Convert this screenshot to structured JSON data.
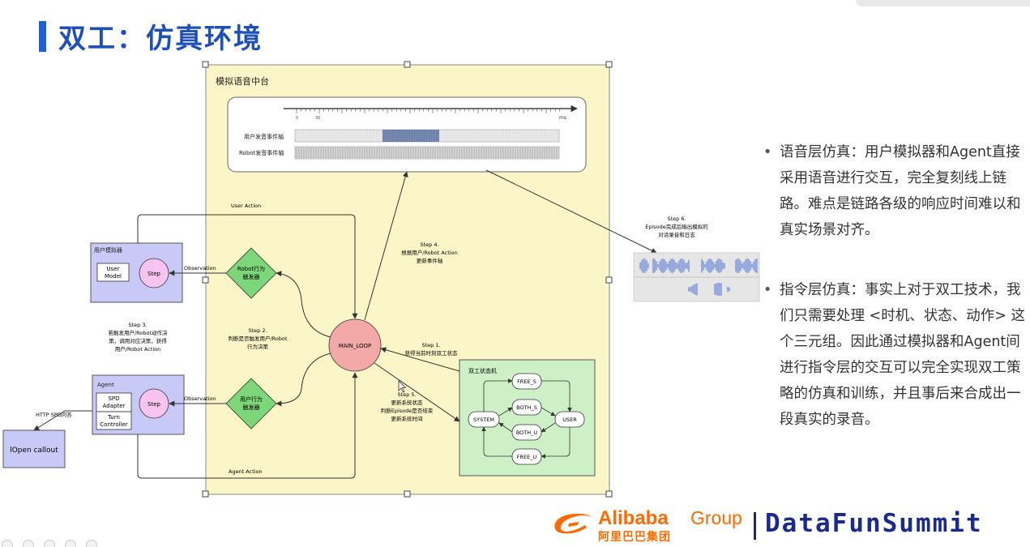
{
  "slide": {
    "title": "双工：仿真环境"
  },
  "diagram": {
    "platform_label": "模拟语音中台",
    "timeline": {
      "tick_start": "0",
      "tick_next": "30",
      "unit": "ms",
      "user_track": "用户发音事件轴",
      "robot_track": "Robot发音事件轴"
    },
    "user_sim": {
      "title": "用户模拟器",
      "model_line1": "User",
      "model_line2": "Model",
      "step": "Step"
    },
    "agent": {
      "title": "Agent",
      "adapter_line1": "SPD",
      "adapter_line2": "Adapter",
      "controller_line1": "Turn",
      "controller_line2": "Controller",
      "step": "Step"
    },
    "callout": "lOpen callout",
    "http_label": "HTTP SPD问答",
    "robot_trigger_line1": "Robot行为",
    "robot_trigger_line2": "触发器",
    "user_trigger_line1": "用户行为",
    "user_trigger_line2": "触发器",
    "observation_top": "Observation",
    "observation_bottom": "Observation",
    "user_action": "User Action",
    "agent_action": "Agent Action",
    "main_loop": "MAIN_LOOP",
    "step1": {
      "title": "Step 1.",
      "line1": "获得当前时刻双工状态"
    },
    "step2": {
      "title": "Step 2.",
      "line1": "判断是否触发用户/Robot",
      "line2": "行为决策"
    },
    "step3": {
      "title": "Step 3.",
      "line1": "若触发用户/Robot动作决",
      "line2": "策，调用对应决策，获得",
      "line3": "用户/Robot Action"
    },
    "step4": {
      "title": "Step 4.",
      "line1": "根据用户/Robot Action",
      "line2": "更新事件轴"
    },
    "step5": {
      "title": "Step 5.",
      "line1": "更新系统状态",
      "line2": "判断Episode是否结束",
      "line3": "更新系统时间"
    },
    "step6": {
      "title": "Step 6.",
      "line1": "Episode完成后输出模拟的",
      "line2": "对话录音和日志"
    },
    "state_machine": {
      "title": "双工状态机",
      "free_s": "FREE_S",
      "both_s": "BOTH_S",
      "both_u": "BOTH_U",
      "free_u": "FREE_U",
      "system": "SYSTEM",
      "user": "USER"
    }
  },
  "bullets": [
    "语音层仿真：用户模拟器和Agent直接采用语音进行交互，完全复刻线上链路。难点是链路各级的响应时间难以和真实场景对齐。",
    "指令层仿真：事实上对于双工技术，我们只需要处理 <时机、状态、动作> 这个三元组。因此通过模拟器和Agent间进行指令层的交互可以完全实现双工策略的仿真和训练，并且事后来合成出一段真实的录音。"
  ],
  "footer": {
    "alibaba": "Alibaba",
    "group": "Group",
    "alibaba_cn": "阿里巴巴集团",
    "datafun": "DataFunSummit"
  },
  "colors": {
    "title_blue": "#1f4fb8",
    "platform_yellow": "#fbf6c8",
    "sim_purple": "#c9c9f7",
    "trigger_green": "#7ed67a",
    "loop_pink": "#f4a9a9",
    "state_green": "#cdf0c6",
    "alibaba_orange": "#ff6a00",
    "datafun_navy": "#1a2b8c"
  }
}
